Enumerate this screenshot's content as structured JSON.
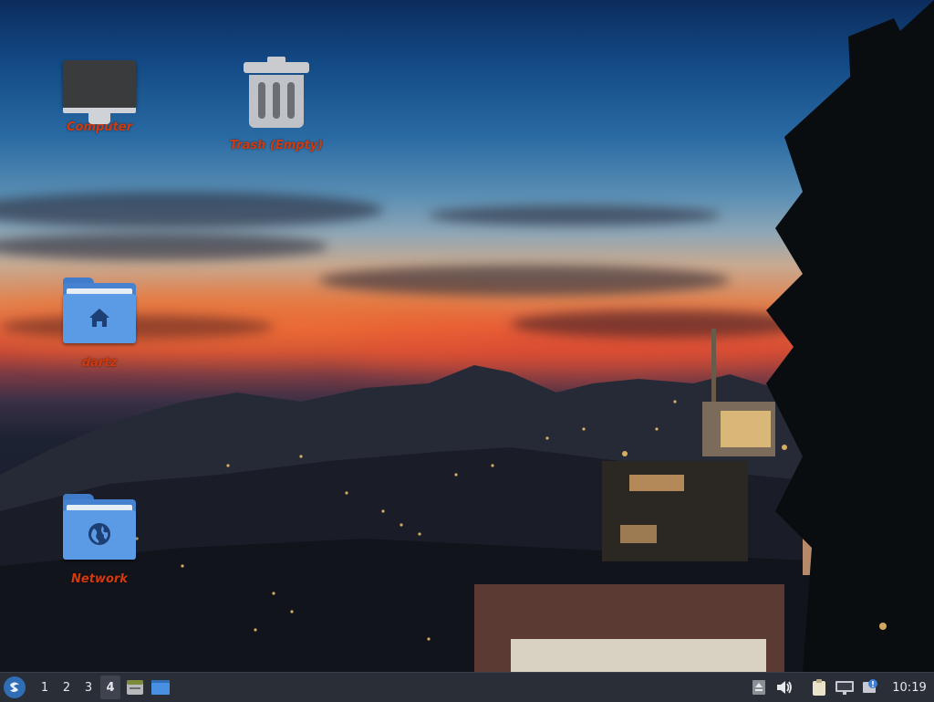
{
  "desktop": {
    "icons": [
      {
        "label": "Computer",
        "icon": "computer-icon"
      },
      {
        "label": "Trash (Empty)",
        "icon": "trash-icon"
      },
      {
        "label": "dartz",
        "icon": "home-folder-icon"
      },
      {
        "label": "Network",
        "icon": "network-folder-icon"
      }
    ],
    "label_color": "#d23a0e"
  },
  "taskbar": {
    "background": "#2a2e36",
    "menu_icon": "app-menu-icon",
    "workspaces": [
      "1",
      "2",
      "3",
      "4"
    ],
    "active_workspace": "4",
    "launchers": [
      {
        "icon": "file-manager-icon"
      },
      {
        "icon": "show-desktop-icon"
      }
    ],
    "tray": [
      {
        "icon": "eject-icon"
      },
      {
        "icon": "volume-icon"
      },
      {
        "icon": "clipboard-icon"
      },
      {
        "icon": "network-display-icon"
      },
      {
        "icon": "updates-icon"
      }
    ],
    "clock": "10:19"
  }
}
